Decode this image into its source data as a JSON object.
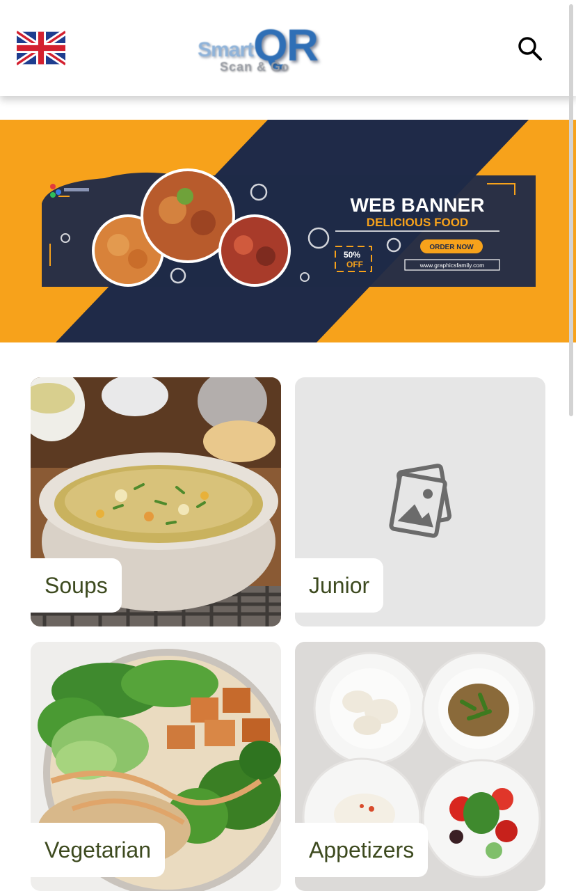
{
  "header": {
    "language_icon": "uk-flag-icon",
    "logo": {
      "main_small": "Smart",
      "main_large": "QR",
      "tagline": "Scan & Go"
    },
    "search_icon": "search-icon"
  },
  "banner": {
    "title": "WEB BANNER",
    "subtitle": "DELICIOUS FOOD",
    "discount_value": "50%",
    "discount_word": "OFF",
    "cta": "ORDER NOW",
    "url": "www.graphicsfamily.com",
    "colors": {
      "orange": "#f7a21b",
      "navy": "#1f2a48"
    }
  },
  "categories": [
    {
      "label": "Soups",
      "image": "soup-photo"
    },
    {
      "label": "Junior",
      "image": "placeholder-image-icon"
    },
    {
      "label": "Vegetarian",
      "image": "salad-bowl-photo"
    },
    {
      "label": "Appetizers",
      "image": "appetizer-plates-photo"
    }
  ],
  "colors": {
    "label_text": "#3d4a1f",
    "placeholder_bg": "#e6e6e6"
  }
}
